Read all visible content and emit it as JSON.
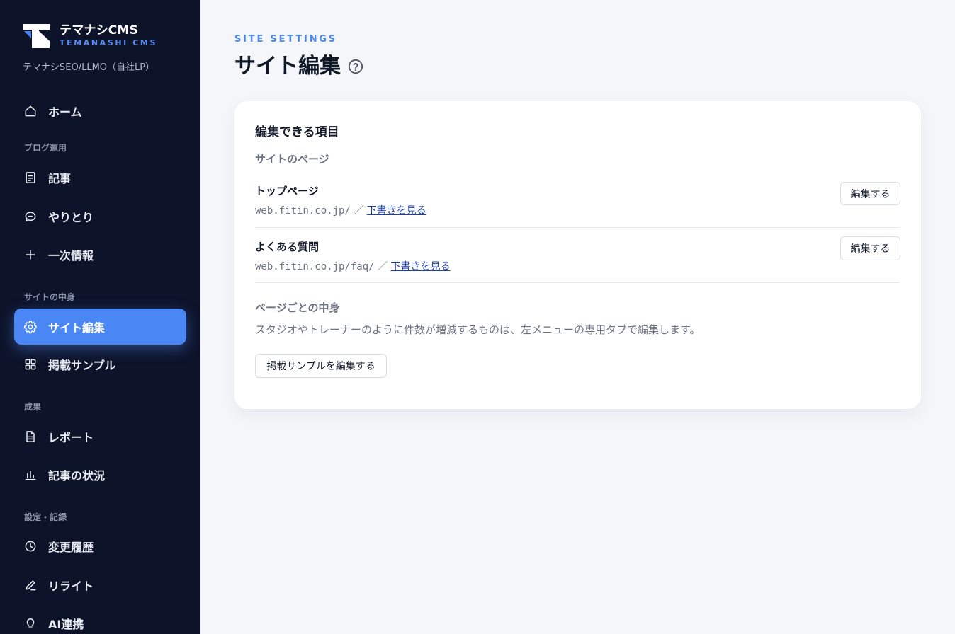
{
  "brand": {
    "name": "テマナシCMS",
    "subtitle": "TEMANASHI CMS",
    "site_name": "テマナシSEO/LLMO（自社LP）"
  },
  "sidebar": {
    "home": "ホーム",
    "sections": {
      "blog": "ブログ運用",
      "site": "サイトの中身",
      "results": "成果",
      "settings": "設定・記録"
    },
    "items": {
      "articles": "記事",
      "conversations": "やりとり",
      "primary_info": "一次情報",
      "site_edit": "サイト編集",
      "samples": "掲載サンプル",
      "report": "レポート",
      "article_status": "記事の状況",
      "history": "変更履歴",
      "rewrite": "リライト",
      "ai": "AI連携"
    }
  },
  "header": {
    "eyebrow": "SITE SETTINGS",
    "title": "サイト編集"
  },
  "card": {
    "title": "編集できる項目",
    "pages_heading": "サイトのページ",
    "pages": [
      {
        "title": "トップページ",
        "url": "web.fitin.co.jp/",
        "separator": "／",
        "draft_link": "下書きを見る",
        "edit_label": "編集する"
      },
      {
        "title": "よくある質問",
        "url": "web.fitin.co.jp/faq/",
        "separator": "／",
        "draft_link": "下書きを見る",
        "edit_label": "編集する"
      }
    ],
    "content_heading": "ページごとの中身",
    "content_note": "スタジオやトレーナーのように件数が増減するものは、左メニューの専用タブで編集します。",
    "samples_button": "掲載サンプルを編集する"
  },
  "colors": {
    "sidebar_bg": "#0d1329",
    "accent": "#4b86f5",
    "link": "#1d3fa6",
    "page_bg": "#f4f6fa"
  }
}
